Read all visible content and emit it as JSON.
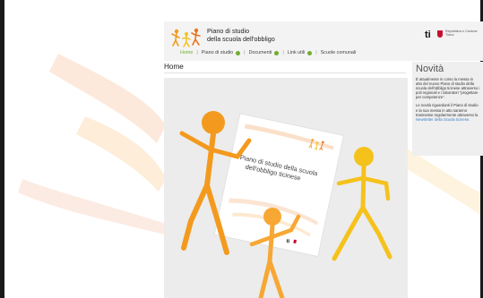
{
  "site": {
    "title_line1": "Piano di studio",
    "title_line2": "della scuola dell'obbligo"
  },
  "canton": {
    "logo_text": "ti",
    "label": "Repubblica e Cantone Ticino"
  },
  "nav": {
    "items": [
      "Home",
      "Piano di studio",
      "Documenti",
      "Link utili",
      "Scuole comunali"
    ]
  },
  "page": {
    "title": "Home"
  },
  "hero": {
    "book_title": "Piano di studio della scuola dell'obbligo ticinese"
  },
  "sidebar": {
    "title": "Novità",
    "paragraph1": "È attualmente in corso la messa in atto del nuovo Piano di studio della scuola dell'obbligo ticinese attraverso i poli regionali e i laboratori \"progettare per competenze\".",
    "paragraph2": "Le novità riguardanti il Piano di studio e la sua messa in atto saranno trasmesse regolarmente attraverso la ",
    "link": "Newsletter della Scuola ticinese",
    "paragraph2_end": "."
  },
  "colors": {
    "accent_green": "#6fae2c",
    "orange": "#f39a1e",
    "dark_orange": "#e8731c",
    "yellow": "#f5c21c",
    "canton_red": "#c8102e"
  },
  "icons": [
    "logo-figures-icon",
    "canton-shield-icon",
    "submenu-dot-icon"
  ]
}
